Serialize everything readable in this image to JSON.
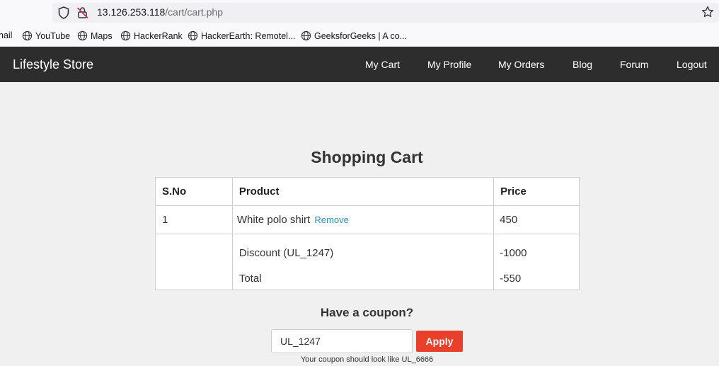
{
  "browser": {
    "url_host": "13.126.253.118",
    "url_path": "/cart/cart.php",
    "bookmarks": [
      {
        "label": "nail"
      },
      {
        "label": "YouTube"
      },
      {
        "label": "Maps"
      },
      {
        "label": "HackerRank"
      },
      {
        "label": "HackerEarth: Remotel..."
      },
      {
        "label": "GeeksforGeeks | A co..."
      }
    ]
  },
  "navbar": {
    "brand": "Lifestyle Store",
    "links": [
      "My Cart",
      "My Profile",
      "My Orders",
      "Blog",
      "Forum",
      "Logout"
    ]
  },
  "cart": {
    "title": "Shopping Cart",
    "headers": {
      "sno": "S.No",
      "product": "Product",
      "price": "Price"
    },
    "items": [
      {
        "sno": "1",
        "product": "White polo shirt",
        "remove_label": "Remove",
        "price": "450"
      }
    ],
    "discount_label": "Discount (UL_1247)",
    "discount_value": "-1000",
    "total_label": "Total",
    "total_value": "-550"
  },
  "coupon": {
    "heading": "Have a coupon?",
    "value": "UL_1247",
    "apply_label": "Apply",
    "hint": "Your coupon should look like UL_6666"
  },
  "colors": {
    "navbar_bg": "#2d2d2d",
    "apply_button": "#e8402a",
    "remove_link": "#2a8fbd",
    "page_bg": "#f0f0f0"
  }
}
